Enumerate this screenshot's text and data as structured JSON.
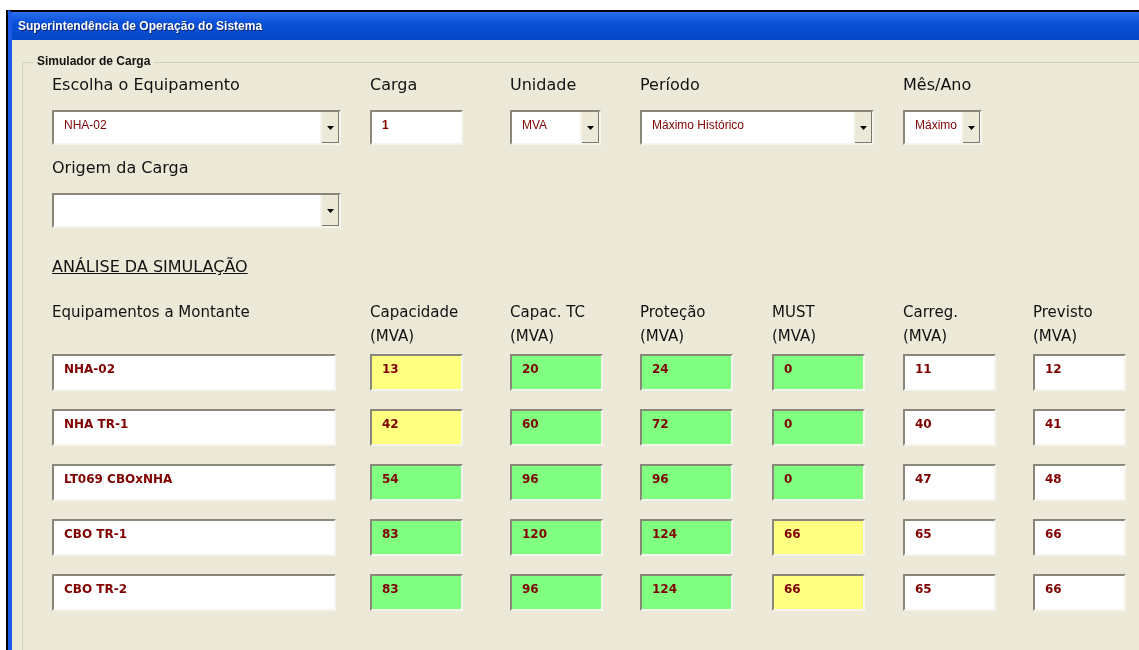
{
  "window": {
    "title": "Superintendência de Operação do Sistema"
  },
  "group": {
    "title": "Simulador de Carga",
    "fields": [
      {
        "label": "Escolha o Equipamento",
        "kind": "dropdown",
        "value": "NHA-02"
      },
      {
        "label": "Carga",
        "kind": "text",
        "value": "1"
      },
      {
        "label": "Unidade",
        "kind": "dropdown",
        "value": "MVA"
      },
      {
        "label": "Período",
        "kind": "dropdown",
        "value": "Máximo Histórico"
      },
      {
        "label": "Mês/Ano",
        "kind": "dropdown",
        "value": "Máximo"
      }
    ],
    "origin": {
      "label": "Origem da Carga",
      "kind": "dropdown"
    },
    "analysis": {
      "title": "ANÁLISE DA SIMULAÇÃO",
      "columns": [
        {
          "title": "Equipamentos a Montante"
        },
        {
          "title": "Capacidade",
          "unit": "(MVA)"
        },
        {
          "title": "Capac. TC",
          "unit": "(MVA)"
        },
        {
          "title": "Proteção",
          "unit": "(MVA)"
        },
        {
          "title": "MUST",
          "unit": "(MVA)"
        },
        {
          "title": "Carreg.",
          "unit": "(MVA)"
        },
        {
          "title": "Previsto",
          "unit": "(MVA)"
        }
      ],
      "rows": [
        {
          "cells": [
            {
              "value": "NHA-02"
            },
            {
              "value": "13",
              "color": "#ffff80"
            },
            {
              "value": "20",
              "color": "#80ff80"
            },
            {
              "value": "24",
              "color": "#80ff80"
            },
            {
              "value": "0",
              "color": "#80ff80"
            },
            {
              "value": "11",
              "color": "#ffffff"
            },
            {
              "value": "12",
              "color": "#ffffff"
            }
          ]
        },
        {
          "cells": [
            {
              "value": "NHA TR-1"
            },
            {
              "value": "42",
              "color": "#ffff80"
            },
            {
              "value": "60",
              "color": "#80ff80"
            },
            {
              "value": "72",
              "color": "#80ff80"
            },
            {
              "value": "0",
              "color": "#80ff80"
            },
            {
              "value": "40",
              "color": "#ffffff"
            },
            {
              "value": "41",
              "color": "#ffffff"
            }
          ]
        },
        {
          "cells": [
            {
              "value": "LT069 CBOxNHA"
            },
            {
              "value": "54",
              "color": "#80ff80"
            },
            {
              "value": "96",
              "color": "#80ff80"
            },
            {
              "value": "96",
              "color": "#80ff80"
            },
            {
              "value": "0",
              "color": "#80ff80"
            },
            {
              "value": "47",
              "color": "#ffffff"
            },
            {
              "value": "48",
              "color": "#ffffff"
            }
          ]
        },
        {
          "cells": [
            {
              "value": "CBO TR-1"
            },
            {
              "value": "83",
              "color": "#80ff80"
            },
            {
              "value": "120",
              "color": "#80ff80"
            },
            {
              "value": "124",
              "color": "#80ff80"
            },
            {
              "value": "66",
              "color": "#ffff80"
            },
            {
              "value": "65",
              "color": "#ffffff"
            },
            {
              "value": "66",
              "color": "#ffffff"
            }
          ]
        },
        {
          "cells": [
            {
              "value": "CBO TR-2"
            },
            {
              "value": "83",
              "color": "#80ff80"
            },
            {
              "value": "96",
              "color": "#80ff80"
            },
            {
              "value": "124",
              "color": "#80ff80"
            },
            {
              "value": "66",
              "color": "#ffff80"
            },
            {
              "value": "65",
              "color": "#ffffff"
            },
            {
              "value": "66",
              "color": "#ffffff"
            }
          ]
        }
      ]
    }
  }
}
